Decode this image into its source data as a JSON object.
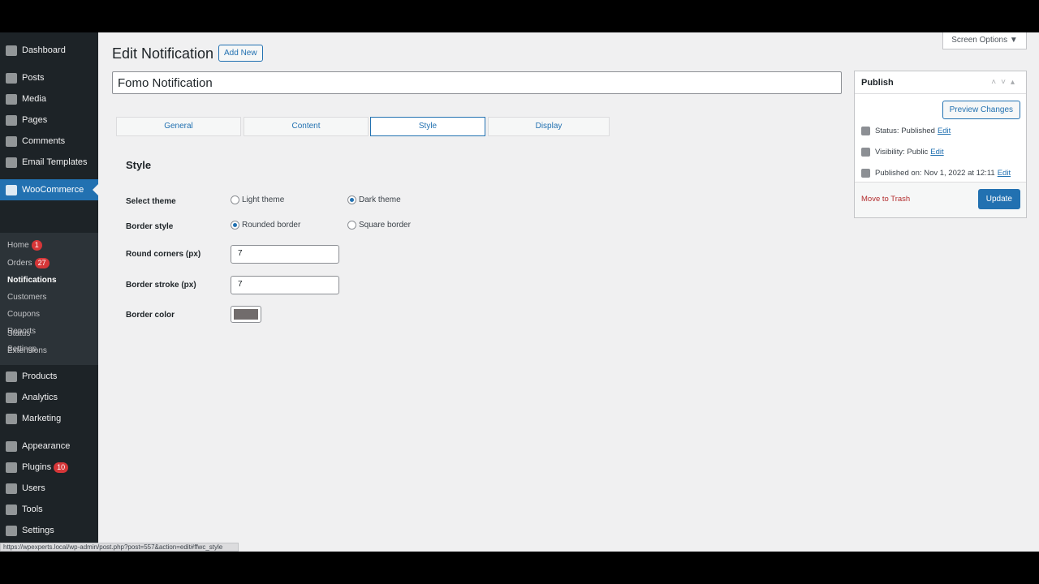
{
  "sidebar": {
    "items": [
      {
        "label": "Dashboard",
        "icon": "dashboard-icon"
      },
      {
        "label": "Posts",
        "icon": "pin-icon"
      },
      {
        "label": "Media",
        "icon": "media-icon"
      },
      {
        "label": "Pages",
        "icon": "pages-icon"
      },
      {
        "label": "Comments",
        "icon": "comment-icon"
      },
      {
        "label": "Email Templates",
        "icon": "email-icon"
      },
      {
        "label": "WooCommerce",
        "icon": "woo-icon"
      },
      {
        "label": "Products",
        "icon": "products-icon"
      },
      {
        "label": "Analytics",
        "icon": "analytics-icon"
      },
      {
        "label": "Marketing",
        "icon": "marketing-icon"
      },
      {
        "label": "Appearance",
        "icon": "appearance-icon"
      },
      {
        "label": "Plugins",
        "icon": "plugins-icon",
        "badge": "10"
      },
      {
        "label": "Users",
        "icon": "users-icon"
      },
      {
        "label": "Tools",
        "icon": "tools-icon"
      },
      {
        "label": "Settings",
        "icon": "settings-icon"
      }
    ],
    "submenu": [
      {
        "label": "Home",
        "badge": "1"
      },
      {
        "label": "Orders",
        "badge": "27"
      },
      {
        "label": "Notifications"
      },
      {
        "label": "Customers"
      },
      {
        "label": "Coupons"
      },
      {
        "label": "Reports"
      },
      {
        "label": "Settings"
      },
      {
        "label": "Status"
      },
      {
        "label": "Extensions"
      }
    ]
  },
  "header": {
    "title": "Edit Notification",
    "add_new": "Add New",
    "screen_options": "Screen Options ▼"
  },
  "post_title": "Fomo Notification",
  "tabs": [
    "General",
    "Content",
    "Style",
    "Display"
  ],
  "style": {
    "heading": "Style",
    "select_theme": "Select theme",
    "light_theme": "Light theme",
    "dark_theme": "Dark theme",
    "border_style": "Border style",
    "rounded": "Rounded border",
    "square": "Square border",
    "round_corners": "Round corners (px)",
    "round_corners_value": "7",
    "border_stroke": "Border stroke (px)",
    "border_stroke_value": "7",
    "border_color": "Border color",
    "border_color_value": "#716c6c"
  },
  "publish": {
    "title": "Publish",
    "preview": "Preview Changes",
    "status": "Status: Published",
    "visibility": "Visibility: Public",
    "published_on": "Published on: Nov 1, 2022 at 12:11",
    "edit": "Edit",
    "trash": "Move to Trash",
    "update": "Update"
  },
  "status_url": "https://wpexperts.local/wp-admin/post.php?post=557&action=edit#ffwc_style"
}
